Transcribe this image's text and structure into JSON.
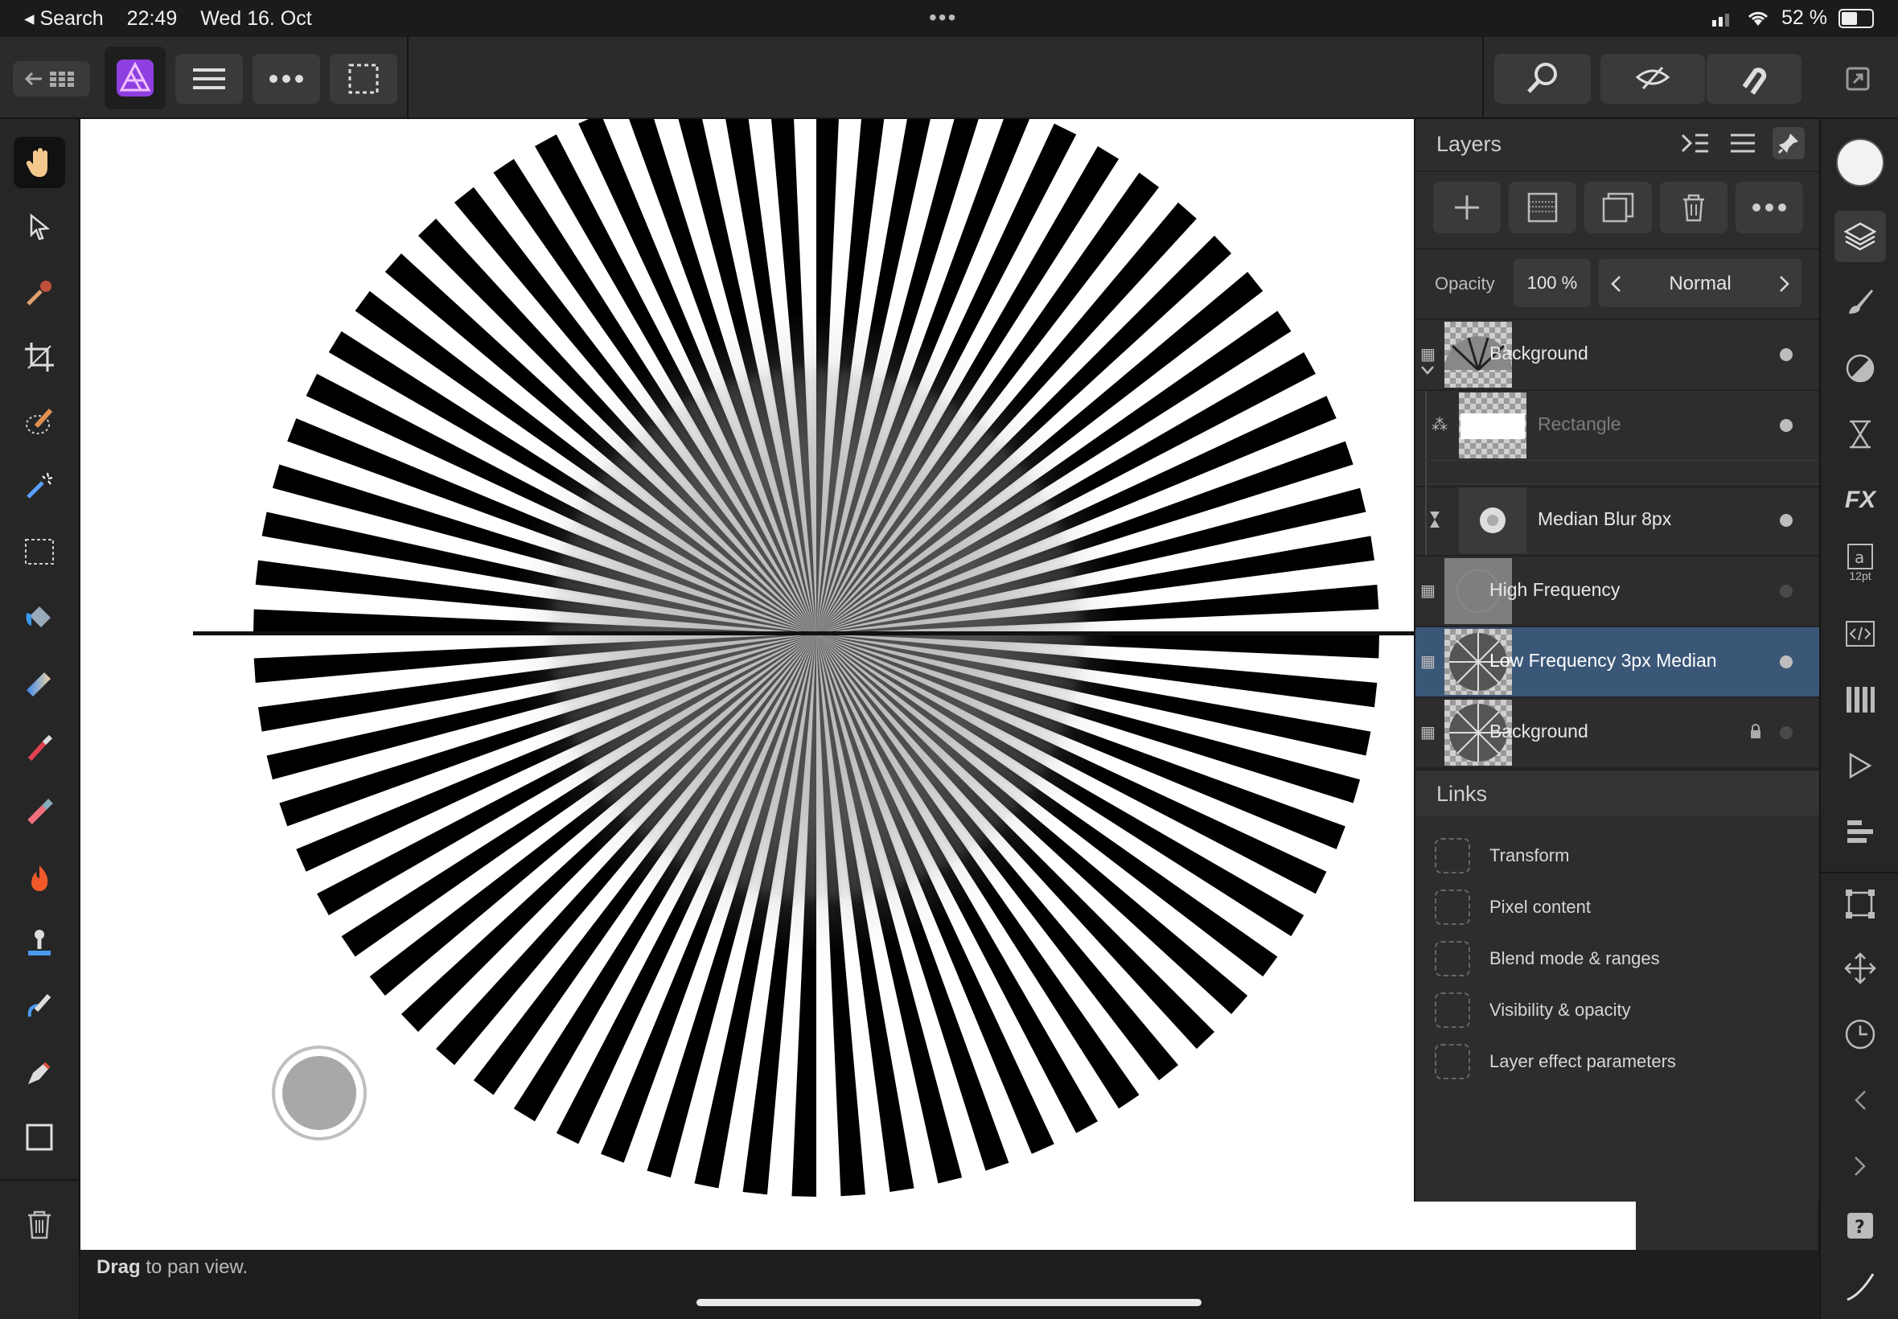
{
  "status_bar": {
    "back_label": "◂ Search",
    "time": "22:49",
    "date": "Wed 16. Oct",
    "center_dots": "•••",
    "battery": "52 %",
    "battery_level": 0.52
  },
  "toolbar": {
    "left_buttons": [
      "back-to-gallery",
      "affinity-photo-logo",
      "menu",
      "more",
      "selection"
    ],
    "right_buttons": [
      "zoom",
      "view-mode",
      "snapping",
      "expand"
    ]
  },
  "tools": [
    "hand-icon",
    "move-icon",
    "color-picker-icon",
    "crop-icon",
    "selection-brush-icon",
    "magic-wand-icon",
    "rectangle-marquee-icon",
    "flood-fill-icon",
    "gradient-icon",
    "paint-brush-icon",
    "erase-brush-icon",
    "burn-icon",
    "clone-icon",
    "smudge-icon",
    "pen-icon",
    "rectangle-icon",
    "trash-icon"
  ],
  "layers_panel": {
    "title": "Layers",
    "opacity_label": "Opacity",
    "opacity_value": "100 %",
    "blend_mode": "Normal",
    "layers": [
      {
        "name": "Background",
        "state": "expanded-group"
      },
      {
        "name": "Rectangle",
        "state": "child-dimmed"
      },
      {
        "name": "Median Blur 8px",
        "state": "filter"
      },
      {
        "name": "High Frequency",
        "state": "normal"
      },
      {
        "name": "Low Frequency 3px Median",
        "state": "selected"
      },
      {
        "name": "Background",
        "state": "locked"
      }
    ],
    "links_title": "Links",
    "links": [
      "Transform",
      "Pixel content",
      "Blend mode & ranges",
      "Visibility & opacity",
      "Layer effect parameters"
    ]
  },
  "right_studio": {
    "text_size_label": "12pt",
    "icons": [
      "color-circle-icon",
      "layers-icon",
      "brushes-icon",
      "adjustments-icon",
      "history-icon",
      "fx-icon",
      "text-styles-icon",
      "code-icon",
      "channels-icon",
      "play-icon",
      "align-icon",
      "transform-icon",
      "navigator-icon",
      "clock-icon",
      "chevron-left-icon",
      "chevron-right-icon",
      "help-icon",
      "pencil-icon"
    ]
  },
  "hint": {
    "bold": "Drag",
    "text": " to pan view."
  },
  "colors": {
    "selected_layer": "#3b5778",
    "panel": "#2d2d2d",
    "accent_logo": "#b04fe0"
  }
}
